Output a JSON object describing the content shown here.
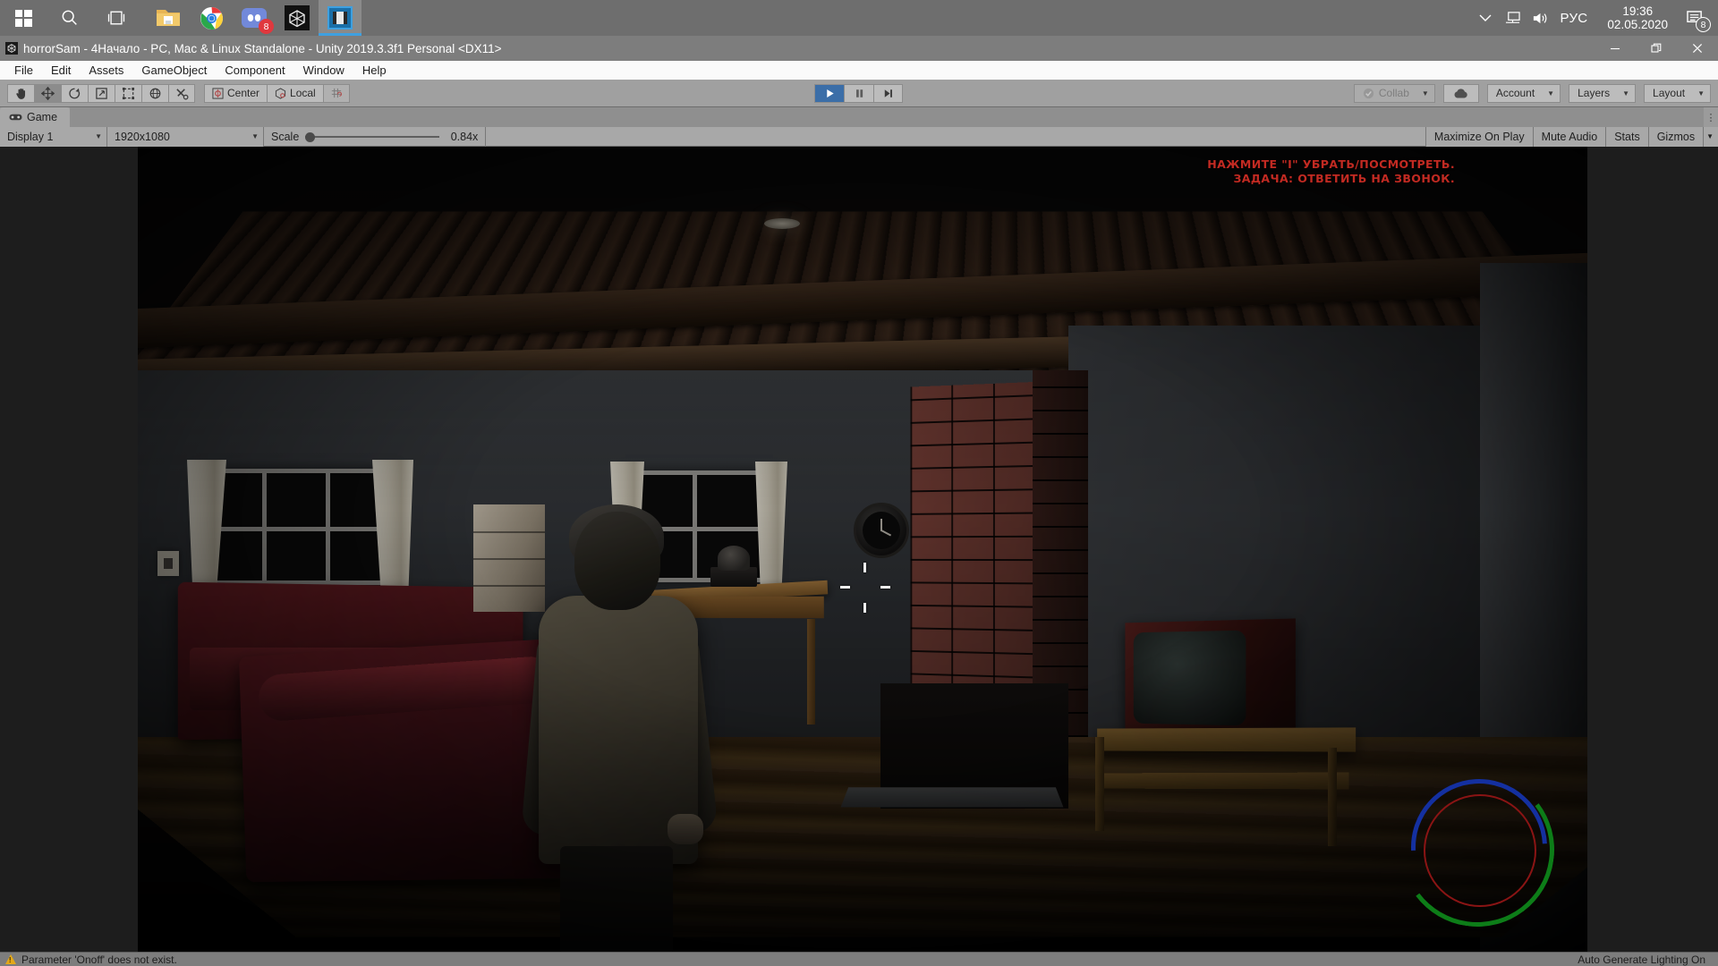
{
  "taskbar": {
    "start_label": "start",
    "search_label": "search-icon",
    "taskview_label": "task-view-icon",
    "apps": [
      {
        "name": "file-explorer",
        "label": "File Explorer"
      },
      {
        "name": "google-chrome",
        "label": "Google Chrome"
      },
      {
        "name": "discord",
        "label": "Discord",
        "badge": "8"
      },
      {
        "name": "unity-hub",
        "label": "Unity"
      },
      {
        "name": "video-editor",
        "label": "Video Editor",
        "selected": true
      }
    ],
    "tray": {
      "chevron": "show-hidden-icons",
      "network": "network-icon",
      "volume": "volume-icon",
      "language": "РУС",
      "time": "19:36",
      "date": "02.05.2020",
      "notifications_badge": "8"
    }
  },
  "titlebar": {
    "text": "horrorSam - 4Начало - PC, Mac & Linux Standalone - Unity 2019.3.3f1 Personal <DX11>",
    "minimize": "–",
    "restore": "❐",
    "close": "✕"
  },
  "menubar": {
    "items": [
      {
        "label": "File"
      },
      {
        "label": "Edit"
      },
      {
        "label": "Assets"
      },
      {
        "label": "GameObject"
      },
      {
        "label": "Component"
      },
      {
        "label": "Window"
      },
      {
        "label": "Help"
      }
    ]
  },
  "toolbar": {
    "tools": [
      {
        "name": "hand-tool",
        "icon": "hand-icon",
        "state": "normal"
      },
      {
        "name": "move-tool",
        "icon": "move-icon",
        "state": "active"
      },
      {
        "name": "rotate-tool",
        "icon": "rotate-icon",
        "state": "normal"
      },
      {
        "name": "scale-tool",
        "icon": "scale-icon",
        "state": "normal"
      },
      {
        "name": "rect-tool",
        "icon": "rect-icon",
        "state": "normal"
      },
      {
        "name": "transform-tool",
        "icon": "transform-icon",
        "state": "normal"
      },
      {
        "name": "custom-editor-tool",
        "icon": "wrench-icon",
        "state": "normal"
      }
    ],
    "pivot_label": "Center",
    "handle_label": "Local",
    "grid_snap": "grid-snap-icon",
    "play": "play-icon",
    "pause": "pause-icon",
    "step": "step-icon",
    "collab_label": "Collab",
    "cloud_label": "cloud-icon",
    "account_label": "Account",
    "layers_label": "Layers",
    "layout_label": "Layout",
    "caret": "▼"
  },
  "gameview": {
    "tab_label": "Game",
    "tab_icon": "gamepad-icon",
    "display": "Display 1",
    "resolution": "1920x1080",
    "scale_label": "Scale",
    "scale_value": "0.84x",
    "maximize_on_play": "Maximize On Play",
    "mute_audio": "Mute Audio",
    "stats": "Stats",
    "gizmos": "Gizmos",
    "caret": "▼"
  },
  "hud": {
    "line1": "НАЖМИТЕ \"I\" УБРАТЬ/ПОСМОТРЕТЬ.",
    "line2": "ЗАДАЧА: ОТВЕТИТЬ НА ЗВОНОК.",
    "color": "#c22a22",
    "crosshair": "crosshair-icon",
    "ring_red": "#8a1414",
    "ring_blue": "#1430a0",
    "ring_green": "#0d7d18"
  },
  "statusbar": {
    "message": "Parameter 'Onoff' does not exist.",
    "lighting": "Auto Generate Lighting On"
  }
}
